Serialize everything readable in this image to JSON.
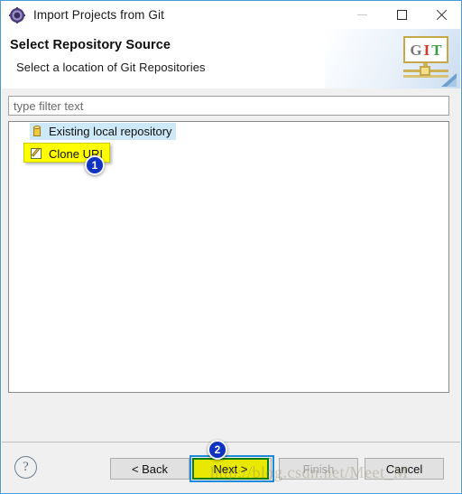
{
  "window": {
    "title": "Import Projects from Git",
    "title_icon": "eclipse-wizard-icon",
    "controls": {
      "minimize": "minimize-icon",
      "maximize": "maximize-icon",
      "close": "close-icon"
    },
    "accent_border": "#4a9ad4"
  },
  "header": {
    "title": "Select Repository Source",
    "subtitle": "Select a location of Git Repositories",
    "banner": {
      "icon": "git-banner-icon",
      "letters": [
        "G",
        "I",
        "T"
      ],
      "letter_colors": [
        "#7a7a7a",
        "#d13b2e",
        "#3f9b46"
      ]
    }
  },
  "filter": {
    "value": "",
    "placeholder": "type filter text"
  },
  "tree": {
    "items": [
      {
        "label": "Existing local repository",
        "icon": "repository-database-icon",
        "selected": true,
        "highlighted": false
      },
      {
        "label": "Clone URI",
        "icon": "clone-uri-document-icon",
        "selected": false,
        "highlighted": true
      }
    ]
  },
  "annotations": {
    "highlight_color": "#ffff00",
    "bubble_color": "#1033c0",
    "outline_color": "#0a7a12",
    "steps": [
      {
        "number": "1",
        "target": "Clone URI"
      },
      {
        "number": "2",
        "target": "Next >"
      }
    ]
  },
  "footer": {
    "help_icon": "help-icon",
    "help_label": "?",
    "buttons": [
      {
        "label": "< Back",
        "name": "back-button",
        "enabled": true
      },
      {
        "label": "Next >",
        "name": "next-button",
        "enabled": true
      },
      {
        "label": "Finish",
        "name": "finish-button",
        "enabled": false
      },
      {
        "label": "Cancel",
        "name": "cancel-button",
        "enabled": true
      }
    ]
  },
  "watermark": {
    "text": "http://blog.csdn.net/Meet_M"
  }
}
